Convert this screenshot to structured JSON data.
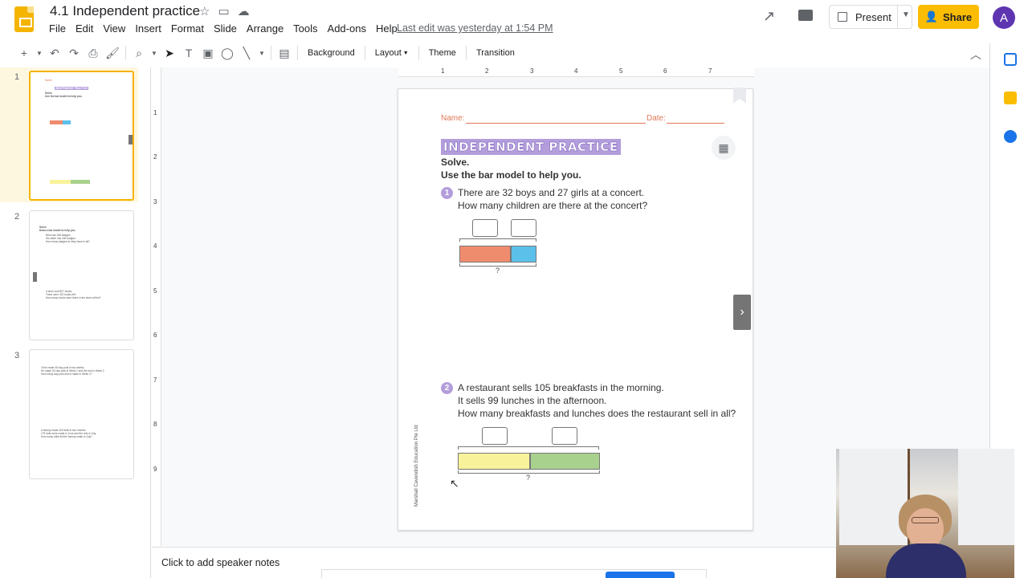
{
  "app": {
    "doc_title": "4.1 Independent practice",
    "last_edit": "Last edit was yesterday at 1:54 PM",
    "menu": [
      "File",
      "Edit",
      "View",
      "Insert",
      "Format",
      "Slide",
      "Arrange",
      "Tools",
      "Add-ons",
      "Help"
    ],
    "present_label": "Present",
    "share_label": "Share",
    "avatar_letter": "A"
  },
  "toolbar": {
    "background": "Background",
    "layout": "Layout",
    "theme": "Theme",
    "transition": "Transition"
  },
  "filmstrip": {
    "slides": [
      {
        "num": "1",
        "lines": [
          "Name:",
          "INDEPENDENT PRACTICE",
          "Solve.",
          "Use the bar model to help you."
        ]
      },
      {
        "num": "2",
        "lines": [
          "Solve.",
          "Draw a bar model to help you."
        ]
      },
      {
        "num": "3",
        "lines": []
      }
    ],
    "thumb2_text": {
      "q1a": "Brea has 348 badges.",
      "q1b": "His sister has 248 badges.",
      "q1c": "How many badges do they have in all?",
      "q2a": "A store sold 827 books.",
      "q2b": "There were 322 books left.",
      "q2c": "How many books were there in the store at first?"
    },
    "thumb3_text": {
      "q1a": "Chris made 46 clay pots in two weeks.",
      "q1b": "He made 20 clay pots in Week 1 and the rest in Week 2.",
      "q1c": "How many clay pots did he make in Week 2?",
      "q2a": "A factory made 425 dolls in two months.",
      "q2b": "175 dolls were made in June and the rest in July.",
      "q2c": "How many dolls did the factory make in July?"
    }
  },
  "ruler": {
    "h": [
      "1",
      "2",
      "3",
      "4",
      "5",
      "6",
      "7"
    ],
    "v": [
      "1",
      "2",
      "3",
      "4",
      "5",
      "6",
      "7",
      "8",
      "9"
    ]
  },
  "slide": {
    "name_label": "Name:",
    "date_label": "Date:",
    "heading": "INDEPENDENT PRACTICE",
    "instruction1": "Solve.",
    "instruction2": "Use the bar model to help you.",
    "q1": {
      "num": "1",
      "line1": "There are 32 boys and 27 girls at a concert.",
      "line2": "How many children are there at the concert?",
      "unknown": "?",
      "colors": [
        "#f08c6e",
        "#5bc0ea"
      ]
    },
    "q2": {
      "num": "2",
      "line1": "A restaurant sells 105 breakfasts in the morning.",
      "line2": "It sells 99 lunches in the afternoon.",
      "line3": "How many breakfasts and lunches does the restaurant sell in all?",
      "unknown": "?",
      "colors": [
        "#f8f39a",
        "#a9d18e"
      ]
    },
    "publisher": "Marshall Cavendish Education Pte Ltd"
  },
  "notes": {
    "placeholder": "Click to add speaker notes"
  }
}
